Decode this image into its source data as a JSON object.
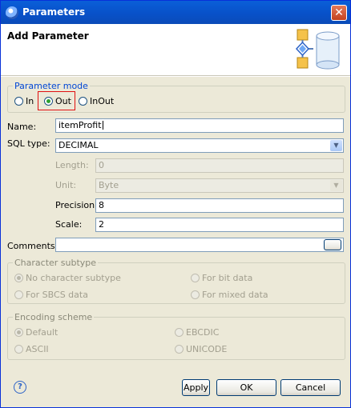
{
  "window": {
    "title": "Parameters"
  },
  "header": {
    "title": "Add Parameter"
  },
  "parameter_mode": {
    "legend": "Parameter mode",
    "options": [
      {
        "label": "In",
        "selected": false
      },
      {
        "label": "Out",
        "selected": true
      },
      {
        "label": "InOut",
        "selected": false
      }
    ]
  },
  "fields": {
    "name_label": "Name:",
    "name_value": "itemProfit",
    "sql_type_label": "SQL type:",
    "sql_type_value": "DECIMAL",
    "length_label": "Length:",
    "length_value": "0",
    "unit_label": "Unit:",
    "unit_value": "Byte",
    "precision_label": "Precision:",
    "precision_value": "8",
    "scale_label": "Scale:",
    "scale_value": "2",
    "comments_label": "Comments:",
    "comments_value": ""
  },
  "character_subtype": {
    "legend": "Character subtype",
    "options": [
      {
        "label": "No character subtype",
        "selected": true
      },
      {
        "label": "For bit data",
        "selected": false
      },
      {
        "label": "For SBCS data",
        "selected": false
      },
      {
        "label": "For mixed data",
        "selected": false
      }
    ]
  },
  "encoding_scheme": {
    "legend": "Encoding scheme",
    "options": [
      {
        "label": "Default",
        "selected": true
      },
      {
        "label": "EBCDIC",
        "selected": false
      },
      {
        "label": "ASCII",
        "selected": false
      },
      {
        "label": "UNICODE",
        "selected": false
      }
    ]
  },
  "buttons": {
    "apply": "Apply",
    "ok": "OK",
    "cancel": "Cancel"
  },
  "icons": {
    "title": "dialog-app-icon",
    "close": "close-icon",
    "header_graphic": "database-parameter-icon",
    "help": "help-icon",
    "dropdown": "chevron-down-icon"
  }
}
